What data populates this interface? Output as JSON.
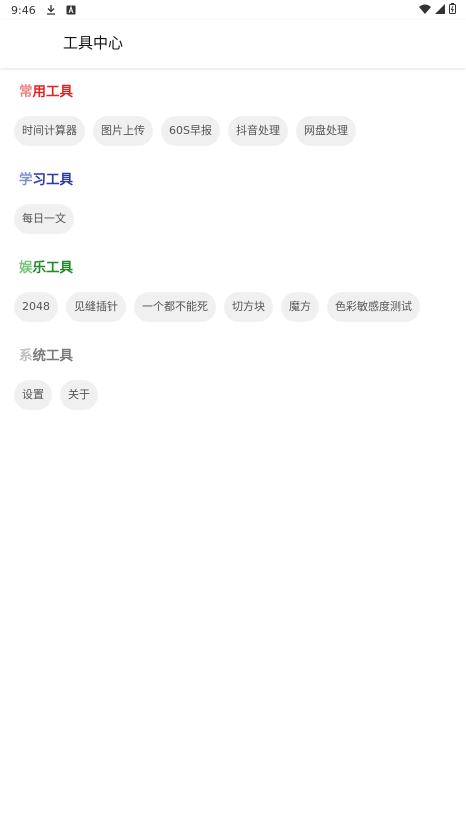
{
  "status_bar": {
    "time": "9:46",
    "icons": [
      "download-icon",
      "a-icon",
      "wifi-icon",
      "signal-icon",
      "battery-icon"
    ]
  },
  "app_bar": {
    "title": "工具中心"
  },
  "sections": [
    {
      "title_first": "常",
      "title_rest": "用工具",
      "colors": {
        "first": "#f08080",
        "rest": "#e52222"
      },
      "items": [
        "时间计算器",
        "图片上传",
        "60S早报",
        "抖音处理",
        "网盘处理"
      ]
    },
    {
      "title_first": "学",
      "title_rest": "习工具",
      "colors": {
        "first": "#7e8fd6",
        "rest": "#2c3a9e"
      },
      "items": [
        "每日一文"
      ]
    },
    {
      "title_first": "娱",
      "title_rest": "乐工具",
      "colors": {
        "first": "#7cc47c",
        "rest": "#1f8a2a"
      },
      "items": [
        "2048",
        "见缝插针",
        "一个都不能死",
        "切方块",
        "魔方",
        "色彩敏感度测试"
      ]
    },
    {
      "title_first": "系",
      "title_rest": "统工具",
      "colors": {
        "first": "#c0c0c0",
        "rest": "#7a7a7a"
      },
      "items": [
        "设置",
        "关于"
      ]
    }
  ]
}
